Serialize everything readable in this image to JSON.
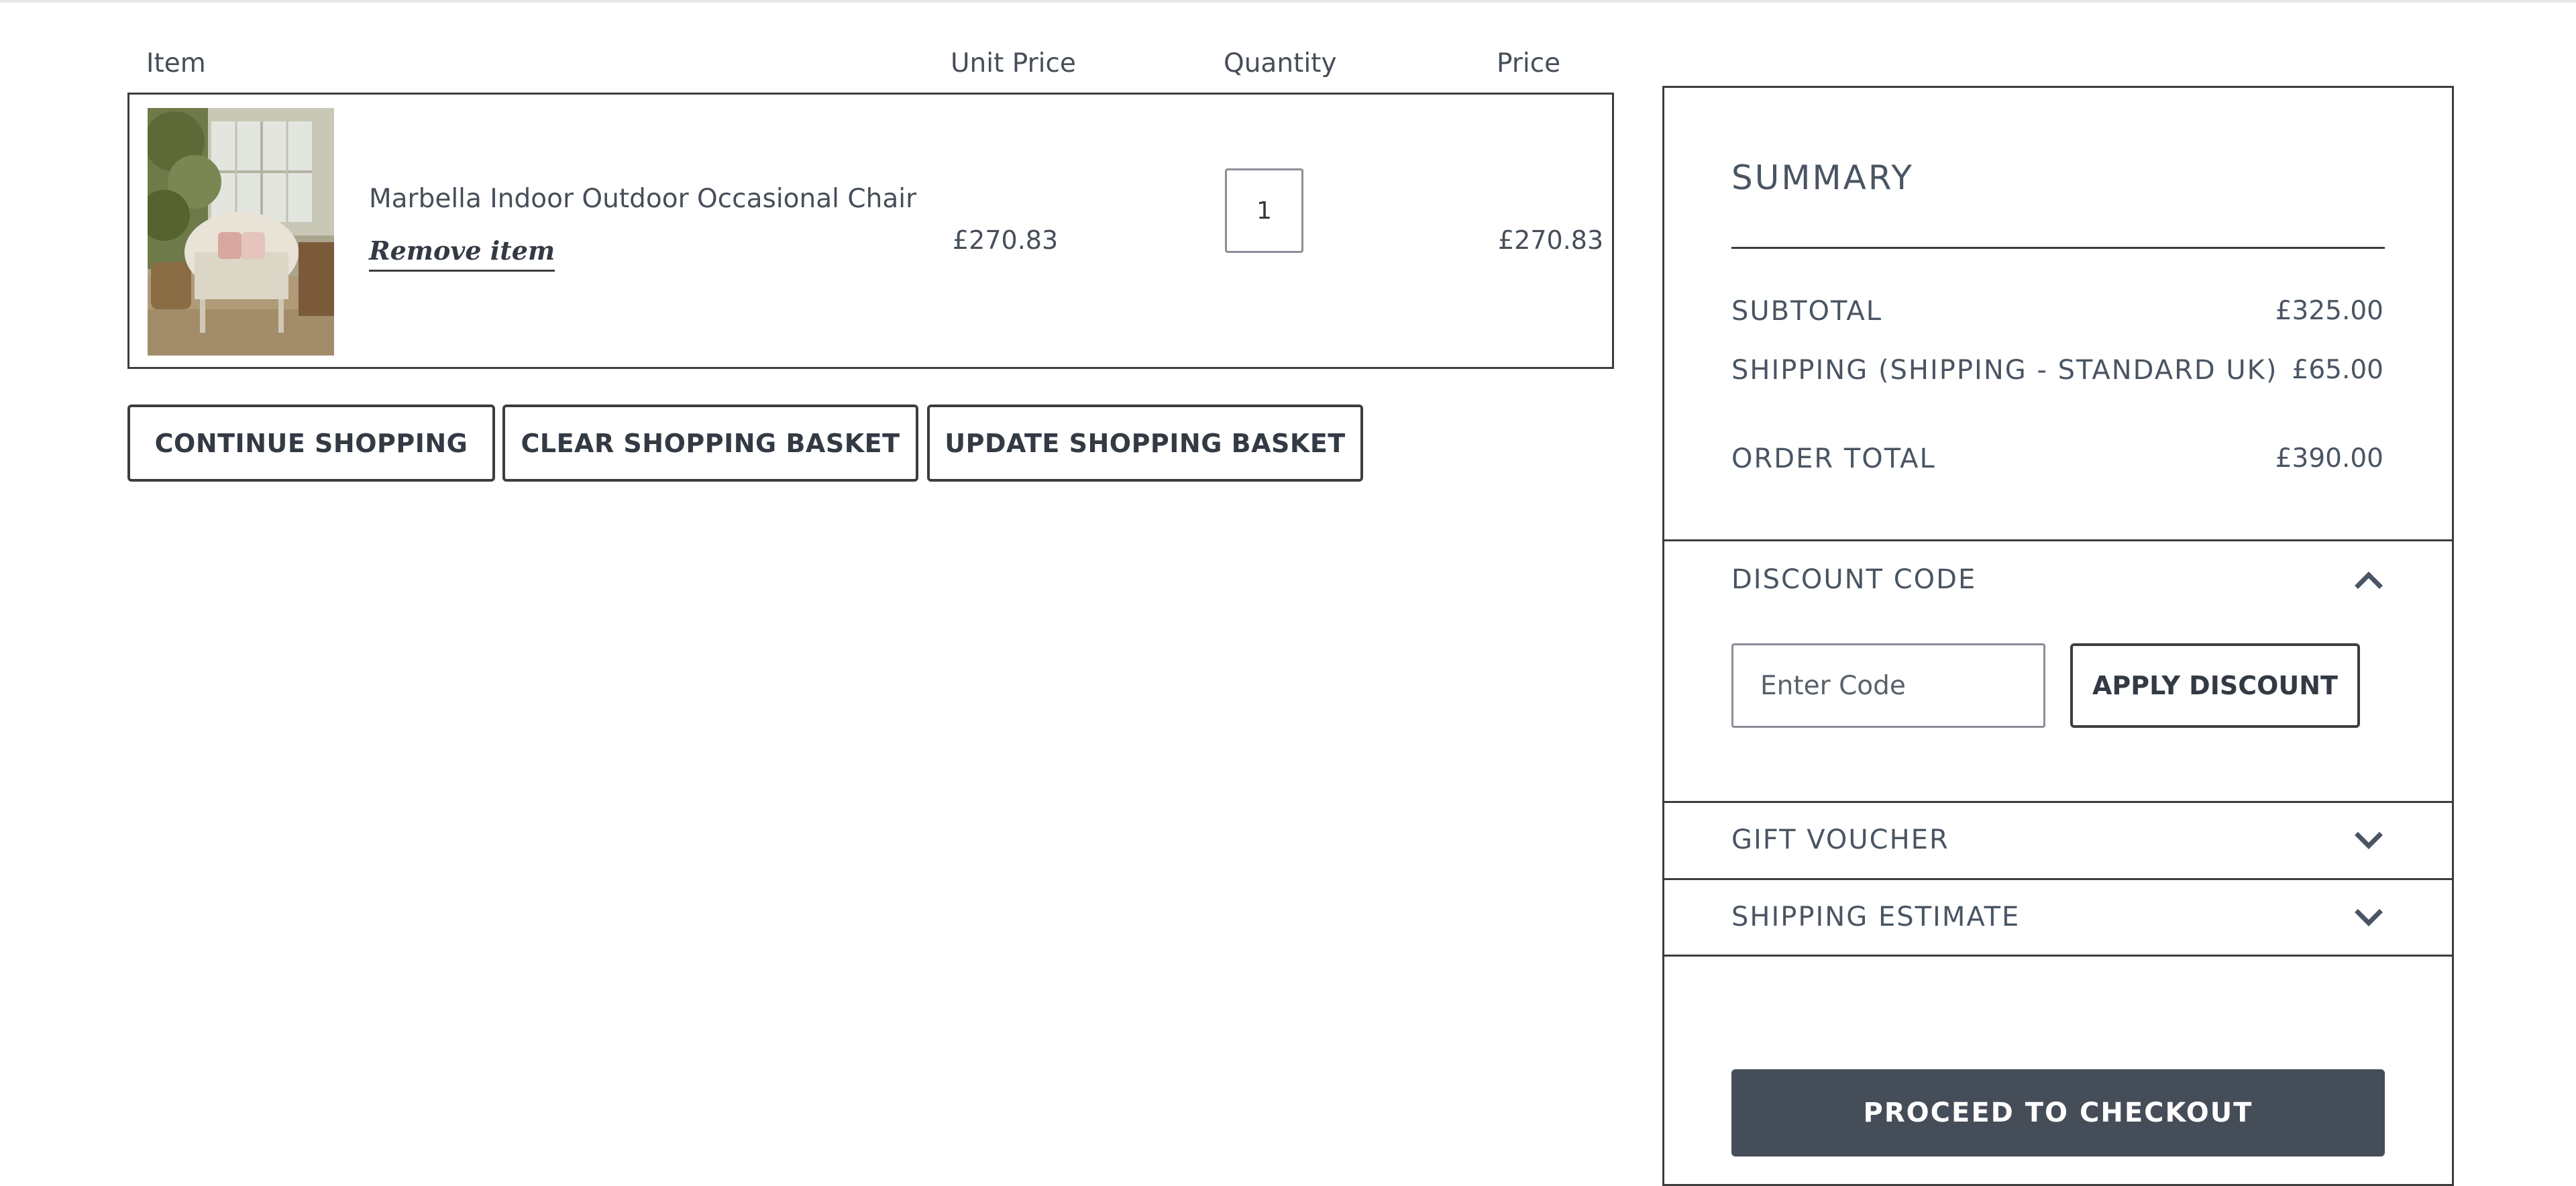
{
  "cart": {
    "headers": {
      "item": "Item",
      "unit_price": "Unit Price",
      "quantity": "Quantity",
      "price": "Price"
    },
    "items": [
      {
        "name": "Marbella Indoor Outdoor Occasional Chair",
        "remove_label": "Remove item",
        "unit_price": "£270.83",
        "quantity": "1",
        "price": "£270.83"
      }
    ]
  },
  "actions": {
    "continue_label": "CONTINUE SHOPPING",
    "clear_label": "CLEAR SHOPPING BASKET",
    "update_label": "UPDATE SHOPPING BASKET"
  },
  "summary": {
    "title": "SUMMARY",
    "subtotal_label": "SUBTOTAL",
    "subtotal_value": "£325.00",
    "shipping_label": "SHIPPING (SHIPPING - STANDARD UK)",
    "shipping_value": "£65.00",
    "total_label": "ORDER TOTAL",
    "total_value": "£390.00",
    "discount": {
      "title": "DISCOUNT CODE",
      "state": "expanded",
      "placeholder": "Enter Code",
      "apply_label": "APPLY DISCOUNT"
    },
    "gift_voucher": {
      "title": "GIFT VOUCHER",
      "state": "collapsed"
    },
    "shipping_estimate": {
      "title": "SHIPPING ESTIMATE",
      "state": "collapsed"
    },
    "checkout_label": "PROCEED TO CHECKOUT"
  },
  "colors": {
    "text": "#46505b",
    "border": "#3d3d3d",
    "checkout_bg": "#454d59",
    "checkout_text": "#ffffff"
  },
  "icons": {
    "discount_chevron": "chevron-up-icon",
    "gift_chevron": "chevron-down-icon",
    "shipping_chevron": "chevron-down-icon"
  }
}
